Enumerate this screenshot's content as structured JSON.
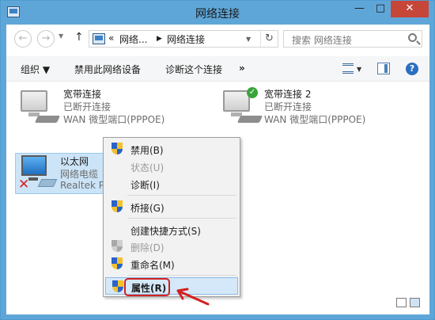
{
  "window": {
    "title": "网络连接",
    "minimize": "—",
    "maximize": "□",
    "close": "✕"
  },
  "address": {
    "back": "←",
    "forward": "→",
    "up": "↑",
    "chevron": "«",
    "crumb1": "网络...",
    "separator": "▶",
    "crumb2": "网络连接",
    "refresh": "↻",
    "search_placeholder": "搜索 网络连接"
  },
  "commands": {
    "organize": "组织 ▼",
    "disable": "禁用此网络设备",
    "diagnose": "诊断这个连接",
    "more": "»"
  },
  "connections": [
    {
      "name": "宽带连接",
      "status": "已断开连接",
      "device": "WAN 微型端口(PPPOE)"
    },
    {
      "name": "宽带连接 2",
      "status": "已断开连接",
      "device": "WAN 微型端口(PPPOE)"
    },
    {
      "name": "以太网",
      "status": "网络电缆",
      "device": "Realtek P"
    }
  ],
  "context_menu": {
    "items": [
      {
        "label": "禁用(B)",
        "enabled": true
      },
      {
        "label": "状态(U)",
        "enabled": false
      },
      {
        "label": "诊断(I)",
        "enabled": true
      },
      {
        "label": "桥接(G)",
        "enabled": true
      },
      {
        "label": "创建快捷方式(S)",
        "enabled": true
      },
      {
        "label": "删除(D)",
        "enabled": false
      },
      {
        "label": "重命名(M)",
        "enabled": true
      },
      {
        "label": "属性(R)",
        "enabled": true,
        "highlighted": true
      }
    ]
  },
  "colors": {
    "titlebar": "#5fa6d8",
    "selection": "#cce4f7",
    "highlight_outline": "#d42020",
    "close_button": "#c7463a"
  },
  "icons": [
    "network-icon",
    "back-icon",
    "forward-icon",
    "up-icon",
    "refresh-icon",
    "search-icon",
    "view-icon",
    "preview-pane-icon",
    "help-icon",
    "uac-shield-icon",
    "check-icon",
    "red-x-icon"
  ]
}
